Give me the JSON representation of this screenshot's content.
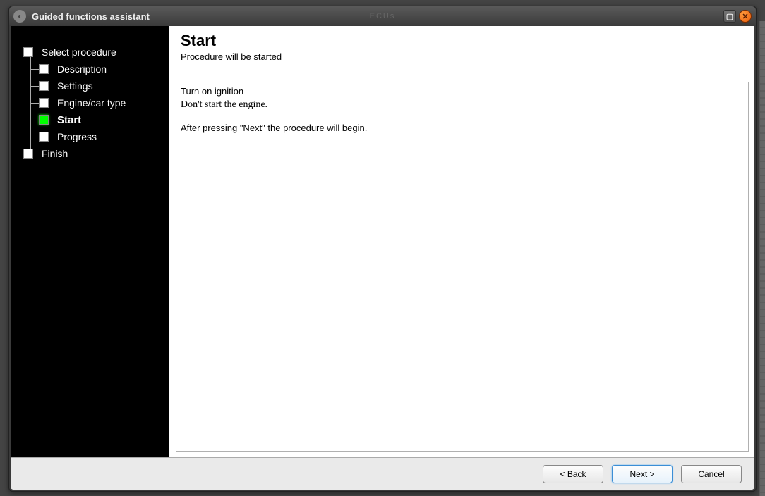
{
  "window": {
    "title": "Guided functions assistant",
    "ghost_text": "ECUs"
  },
  "sidebar": {
    "items": [
      {
        "label": "Select procedure",
        "level": "root",
        "state": "done"
      },
      {
        "label": "Description",
        "level": "child",
        "state": "done"
      },
      {
        "label": "Settings",
        "level": "child",
        "state": "done"
      },
      {
        "label": "Engine/car type",
        "level": "child",
        "state": "done"
      },
      {
        "label": "Start",
        "level": "child",
        "state": "current"
      },
      {
        "label": "Progress",
        "level": "child",
        "state": "pending"
      },
      {
        "label": "Finish",
        "level": "root",
        "state": "pending"
      }
    ]
  },
  "page": {
    "title": "Start",
    "subtitle": "Procedure will be started",
    "instruction_line1": "Turn on ignition",
    "instruction_line2": "Don't start the engine.",
    "instruction_line3": "After pressing \"Next\" the procedure will begin."
  },
  "footer": {
    "back_prefix": "< ",
    "back_key": "B",
    "back_rest": "ack",
    "next_key": "N",
    "next_rest": "ext >",
    "cancel": "Cancel"
  }
}
